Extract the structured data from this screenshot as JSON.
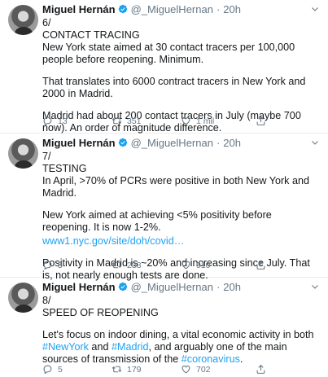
{
  "tweets": [
    {
      "author": "Miguel Hernán",
      "handle": "@_MiguelHernan",
      "time": "20h",
      "number": "6/",
      "heading": "CONTACT TRACING",
      "paragraphs": [
        "New York state aimed at 30 contact tracers per 100,000 people before reopening. Minimum.",
        "That translates into 6000 contract tracers in New York and 2000 in Madrid.",
        "Madrid had about 200 contact tracers in July (maybe 700 now). An order of magnitude difference."
      ],
      "replies": "13",
      "retweets": "351",
      "likes": "1 mil"
    },
    {
      "author": "Miguel Hernán",
      "handle": "@_MiguelHernan",
      "time": "20h",
      "number": "7/",
      "heading": "TESTING",
      "p1": "In April, >70% of PCRs were positive in both New York and Madrid.",
      "p2": "New York aimed at achieving <5% positivity before reopening. It is now 1-2%.",
      "link": "www1.nyc.gov/site/doh/covid…",
      "p3": "Positivity in Madrid is ~20% and increasing since July. That is, not nearly enough tests are done.",
      "replies": "5",
      "retweets": "238",
      "likes": "910"
    },
    {
      "author": "Miguel Hernán",
      "handle": "@_MiguelHernan",
      "time": "20h",
      "number": "8/",
      "heading": "SPEED OF REOPENING",
      "p_start": "Let's focus on indoor dining, a vital economic activity in both ",
      "hashtag1": "#NewYork",
      "p_and": " and ",
      "hashtag2": "#Madrid",
      "p_mid": ", and arguably one of the main sources of transmission of the ",
      "hashtag3": "#coronavirus",
      "p_end": ".",
      "replies": "5",
      "retweets": "179",
      "likes": "702"
    }
  ],
  "colors": {
    "accent": "#1da1f2",
    "muted": "#657786",
    "text": "#14171a",
    "divider": "#e6ecf0"
  },
  "icons": [
    "verified-badge-icon",
    "chevron-down-icon",
    "reply-icon",
    "retweet-icon",
    "like-icon",
    "share-icon"
  ]
}
